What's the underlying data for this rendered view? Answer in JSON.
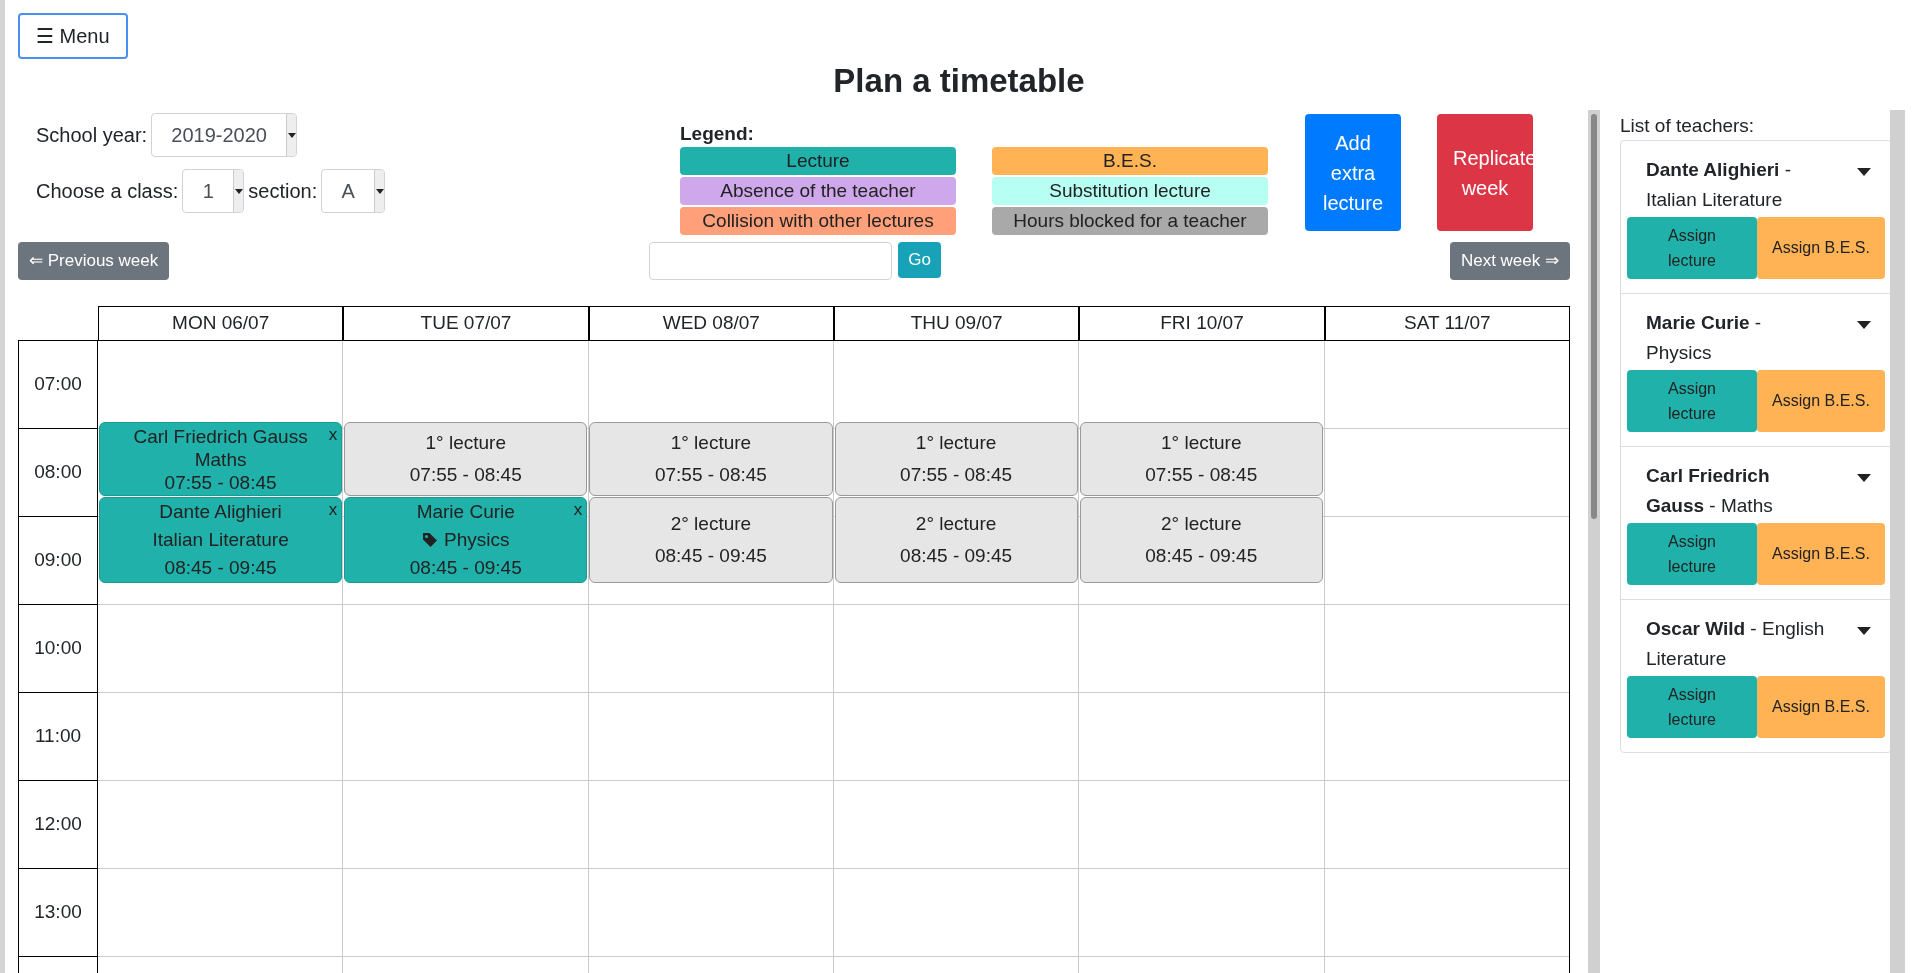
{
  "menu_button": "☰ Menu",
  "title": "Plan a timetable",
  "filters": {
    "school_year": {
      "label": "School year:",
      "value": "2019-2020"
    },
    "class": {
      "label": "Choose a class:",
      "value": "1"
    },
    "section": {
      "label": "section:",
      "value": "A"
    }
  },
  "legend": {
    "title": "Legend:",
    "items": [
      {
        "label": "Lecture",
        "color": "#20b2aa"
      },
      {
        "label": "Absence of the teacher",
        "color": "#cfa8ec"
      },
      {
        "label": "Collision with other lectures",
        "color": "#ffa07a"
      },
      {
        "label": "B.E.S.",
        "color": "#ffb354"
      },
      {
        "label": "Substitution lecture",
        "color": "#b6fff2"
      },
      {
        "label": "Hours blocked for a teacher",
        "color": "#a9a9a9"
      }
    ]
  },
  "actions": [
    {
      "label": "Add extra lecture",
      "kind": "primary"
    },
    {
      "label": "Replicate week",
      "kind": "danger"
    }
  ],
  "nav": {
    "previous": "⇐ Previous week",
    "go": "Go",
    "next": "Next week ⇒"
  },
  "time_slots": [
    "07:00",
    "08:00",
    "09:00",
    "10:00",
    "11:00",
    "12:00",
    "13:00"
  ],
  "days": [
    {
      "label": "MON 06/07",
      "events": [
        {
          "kind": "lecture",
          "title": "Carl Friedrich Gauss",
          "subject": "Maths",
          "tagged": false,
          "time": "07:55 - 08:45",
          "close": "x"
        },
        {
          "kind": "lecture",
          "title": "Dante Alighieri",
          "subject": "Italian Literature",
          "tagged": false,
          "time": "08:45 - 09:45",
          "close": "x"
        }
      ]
    },
    {
      "label": "TUE 07/07",
      "events": [
        {
          "kind": "free",
          "title": "1° lecture",
          "time": "07:55 - 08:45"
        },
        {
          "kind": "lecture",
          "title": "Marie Curie",
          "subject": "Physics",
          "tagged": true,
          "time": "08:45 - 09:45",
          "close": "x"
        }
      ]
    },
    {
      "label": "WED 08/07",
      "events": [
        {
          "kind": "free",
          "title": "1° lecture",
          "time": "07:55 - 08:45"
        },
        {
          "kind": "free",
          "title": "2° lecture",
          "time": "08:45 - 09:45"
        }
      ]
    },
    {
      "label": "THU 09/07",
      "events": [
        {
          "kind": "free",
          "title": "1° lecture",
          "time": "07:55 - 08:45"
        },
        {
          "kind": "free",
          "title": "2° lecture",
          "time": "08:45 - 09:45"
        }
      ]
    },
    {
      "label": "FRI 10/07",
      "events": [
        {
          "kind": "free",
          "title": "1° lecture",
          "time": "07:55 - 08:45"
        },
        {
          "kind": "free",
          "title": "2° lecture",
          "time": "08:45 - 09:45"
        }
      ]
    },
    {
      "label": "SAT 11/07"
    }
  ],
  "teachers_panel": {
    "title": "List of teachers:",
    "teachers": [
      {
        "name": "**Dante Alighieri** - Italian Literature",
        "assign_lecture": "Assign lecture",
        "assign_bes": "Assign B.E.S."
      },
      {
        "name": "**Marie Curie** - Physics",
        "assign_lecture": "Assign lecture",
        "assign_bes": "Assign B.E.S."
      },
      {
        "name": "**Carl Friedrich Gauss** - Maths",
        "assign_lecture": "Assign lecture",
        "assign_bes": "Assign B.E.S."
      },
      {
        "name": "**Oscar Wild** - English Literature",
        "assign_lecture": "Assign lecture",
        "assign_bes": "Assign B.E.S."
      }
    ]
  }
}
